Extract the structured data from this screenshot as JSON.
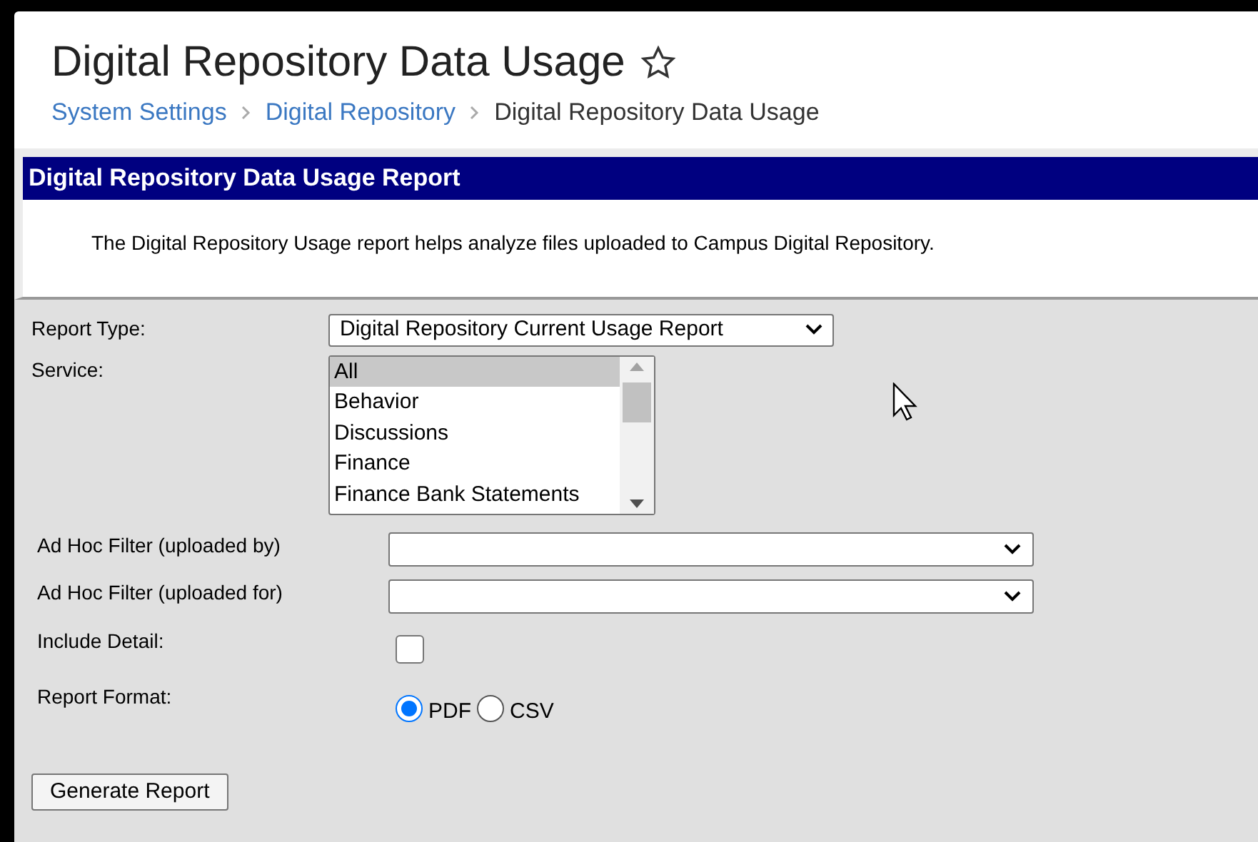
{
  "header": {
    "title": "Digital Repository Data Usage",
    "favorite": false,
    "breadcrumbs": [
      {
        "label": "System Settings",
        "kind": "link"
      },
      {
        "label": "Digital Repository",
        "kind": "link"
      },
      {
        "label": "Digital Repository Data Usage",
        "kind": "current"
      }
    ]
  },
  "report": {
    "title": "Digital Repository Data Usage Report",
    "description": "The Digital Repository Usage report helps analyze files uploaded to Campus Digital Repository."
  },
  "form": {
    "report_type": {
      "label": "Report Type:",
      "value": "Digital Repository Current Usage Report"
    },
    "service": {
      "label": "Service:",
      "options": [
        {
          "label": "All",
          "selected": true
        },
        {
          "label": "Behavior",
          "selected": false
        },
        {
          "label": "Discussions",
          "selected": false
        },
        {
          "label": "Finance",
          "selected": false
        },
        {
          "label": "Finance Bank Statements",
          "selected": false
        }
      ]
    },
    "filters": [
      {
        "label": "Ad Hoc Filter (uploaded by)"
      },
      {
        "label": "Ad Hoc Filter (uploaded for)"
      }
    ],
    "include_detail": {
      "label": "Include Detail:",
      "checked": false
    },
    "report_format": {
      "label": "Report Format:",
      "options": [
        {
          "label": "PDF",
          "selected": true
        },
        {
          "label": "CSV",
          "selected": false
        }
      ]
    },
    "generate_button": "Generate Report"
  }
}
